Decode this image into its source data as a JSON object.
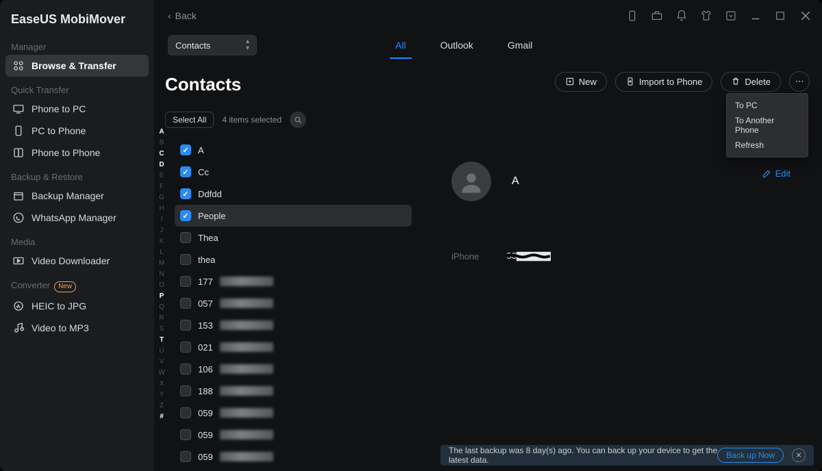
{
  "brand": "EaseUS MobiMover",
  "sidebar": {
    "sections": [
      {
        "title": "Manager",
        "items": [
          {
            "label": "Browse & Transfer",
            "icon": "grid",
            "active": true
          }
        ]
      },
      {
        "title": "Quick Transfer",
        "items": [
          {
            "label": "Phone to PC",
            "icon": "monitor"
          },
          {
            "label": "PC to Phone",
            "icon": "phone"
          },
          {
            "label": "Phone to Phone",
            "icon": "phones"
          }
        ]
      },
      {
        "title": "Backup & Restore",
        "items": [
          {
            "label": "Backup Manager",
            "icon": "backup"
          },
          {
            "label": "WhatsApp Manager",
            "icon": "whatsapp"
          }
        ]
      },
      {
        "title": "Media",
        "items": [
          {
            "label": "Video Downloader",
            "icon": "video"
          }
        ]
      },
      {
        "title": "Converter",
        "badge": "New",
        "items": [
          {
            "label": "HEIC to JPG",
            "icon": "heic"
          },
          {
            "label": "Video to MP3",
            "icon": "mp3"
          }
        ]
      }
    ]
  },
  "titlebar": {
    "back": "Back"
  },
  "dropdown": {
    "value": "Contacts"
  },
  "tabs": [
    {
      "label": "All",
      "active": true
    },
    {
      "label": "Outlook"
    },
    {
      "label": "Gmail"
    }
  ],
  "page_title": "Contacts",
  "actions": {
    "new": "New",
    "import": "Import to Phone",
    "delete": "Delete"
  },
  "context_menu": [
    "To PC",
    "To Another Phone",
    "Refresh"
  ],
  "select": {
    "select_all": "Select All",
    "status": "4 items selected"
  },
  "alpha": [
    "A",
    "B",
    "C",
    "D",
    "E",
    "F",
    "G",
    "H",
    "I",
    "J",
    "K",
    "L",
    "M",
    "N",
    "O",
    "P",
    "Q",
    "R",
    "S",
    "T",
    "U",
    "V",
    "W",
    "X",
    "Y",
    "Z",
    "#"
  ],
  "alpha_on": [
    "A",
    "C",
    "D",
    "P",
    "T",
    "#"
  ],
  "contacts": [
    {
      "name": "A",
      "checked": true
    },
    {
      "name": "Cc",
      "checked": true
    },
    {
      "name": "Ddfdd",
      "checked": true
    },
    {
      "name": "People",
      "checked": true,
      "selected": true
    },
    {
      "name": "Thea",
      "checked": false
    },
    {
      "name": "thea",
      "checked": false
    },
    {
      "name": "177",
      "checked": false,
      "blur": true
    },
    {
      "name": "057",
      "checked": false,
      "blur": true
    },
    {
      "name": "153",
      "checked": false,
      "blur": true
    },
    {
      "name": "021",
      "checked": false,
      "blur": true
    },
    {
      "name": "106",
      "checked": false,
      "blur": true
    },
    {
      "name": "188",
      "checked": false,
      "blur": true
    },
    {
      "name": "059",
      "checked": false,
      "blur": true
    },
    {
      "name": "059",
      "checked": false,
      "blur": true
    },
    {
      "name": "059",
      "checked": false,
      "blur": true
    }
  ],
  "detail": {
    "name": "A",
    "phone_label": "iPhone",
    "phone_value": "83▇▇▇▇▇",
    "edit": "Edit"
  },
  "bottom": {
    "msg": "The last backup was 8 day(s) ago. You can back up your device to get the latest data.",
    "btn": "Back up Now"
  }
}
